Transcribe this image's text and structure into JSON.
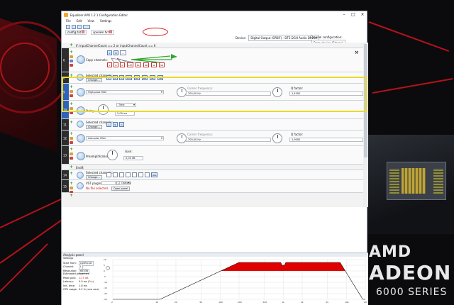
{
  "window": {
    "title": "Equalizer APO 1.2.1 Configuration Editor",
    "menu": [
      "File",
      "Edit",
      "View",
      "Settings"
    ]
  },
  "tabs": [
    {
      "label": "config.txt"
    },
    {
      "label": "speaker.txt"
    }
  ],
  "device_bar": {
    "device_label": "Device:",
    "device_value": "Digital Output (SPDIF) - DTS DGH Audio Device",
    "channel_label": "Channel configuration:",
    "channel_value": "From device (Stereo)"
  },
  "rows": {
    "condition": "If: inputChannelCount == 2 or inputChannelCount == 6",
    "copy": {
      "label": "Copy channels:",
      "top_channels": [
        "L",
        "R",
        "—"
      ],
      "bottom_channels": [
        "L",
        "R",
        "C",
        "LFE",
        "RL",
        "RR",
        "SL",
        "SR"
      ]
    },
    "sel1": {
      "label": "Selected channels:",
      "button": "Change...",
      "channels": [
        "L",
        "R",
        "C",
        "LFE",
        "RL",
        "RR",
        "SL",
        "SR"
      ]
    },
    "hp1": {
      "type": "High-pass filter",
      "freq_label": "Corner frequency:",
      "freq_value": "200,00 Hz",
      "q_label": "Q factor:",
      "q_value": "1,4000"
    },
    "delay": {
      "label": "Delay:",
      "unit": "Time",
      "value": "5,00 ms"
    },
    "sel2": {
      "label": "Selected channels:",
      "button": "Change...",
      "channels": [
        "L",
        "R",
        "C"
      ]
    },
    "lp": {
      "type": "Low-pass filter",
      "freq_label": "Corner frequency:",
      "freq_value": "200,00 Hz",
      "q_label": "Q factor:",
      "q_value": "1,9000"
    },
    "preamp": {
      "label": "Preamplification:",
      "gain_label": "Gain:",
      "gain_value": "0,00 dB"
    },
    "endif": {
      "label": "EndIf:"
    },
    "sel3": {
      "label": "Selected channels:",
      "button": "Change...",
      "channels": [
        "",
        "",
        "",
        "",
        "",
        "",
        "",
        "ALL"
      ]
    },
    "vst": {
      "label": "VST plugin:",
      "options": "Options",
      "error": "No file selected.",
      "button": "Open panel"
    }
  },
  "analysis": {
    "header": "Analysis panel",
    "settings_label": "Settings",
    "start_from_label": "Start from:",
    "start_from_value": "config.txt",
    "channel_label": "Channel:",
    "channel_value": "L",
    "resolution_label": "Resolution:",
    "resolution_value": "65536",
    "estimated_label": "Estimated properties",
    "peak_gain_label": "Peak gain:",
    "peak_gain_value": "12.5 dB",
    "latency_label": "Latency:",
    "latency_value": "0.0 ms (0 s)",
    "init_time_label": "Init. time:",
    "init_time_value": "1.8 ms",
    "cpu_label": "CPU usage:",
    "cpu_value": "0.2 % (one core)",
    "x_ticks": [
      "2",
      "10",
      "20",
      "50",
      "100",
      "200",
      "500",
      "1k",
      "2k",
      "5k",
      "10k",
      "20k"
    ],
    "y_ticks": [
      "10",
      "5",
      "0",
      "-5",
      "-10",
      "-15",
      "-20",
      "-25"
    ],
    "response_color": "#e00000"
  },
  "desktop": {
    "amd": "AMD",
    "radeon": "ADEON",
    "series": "6000 SERIES"
  }
}
